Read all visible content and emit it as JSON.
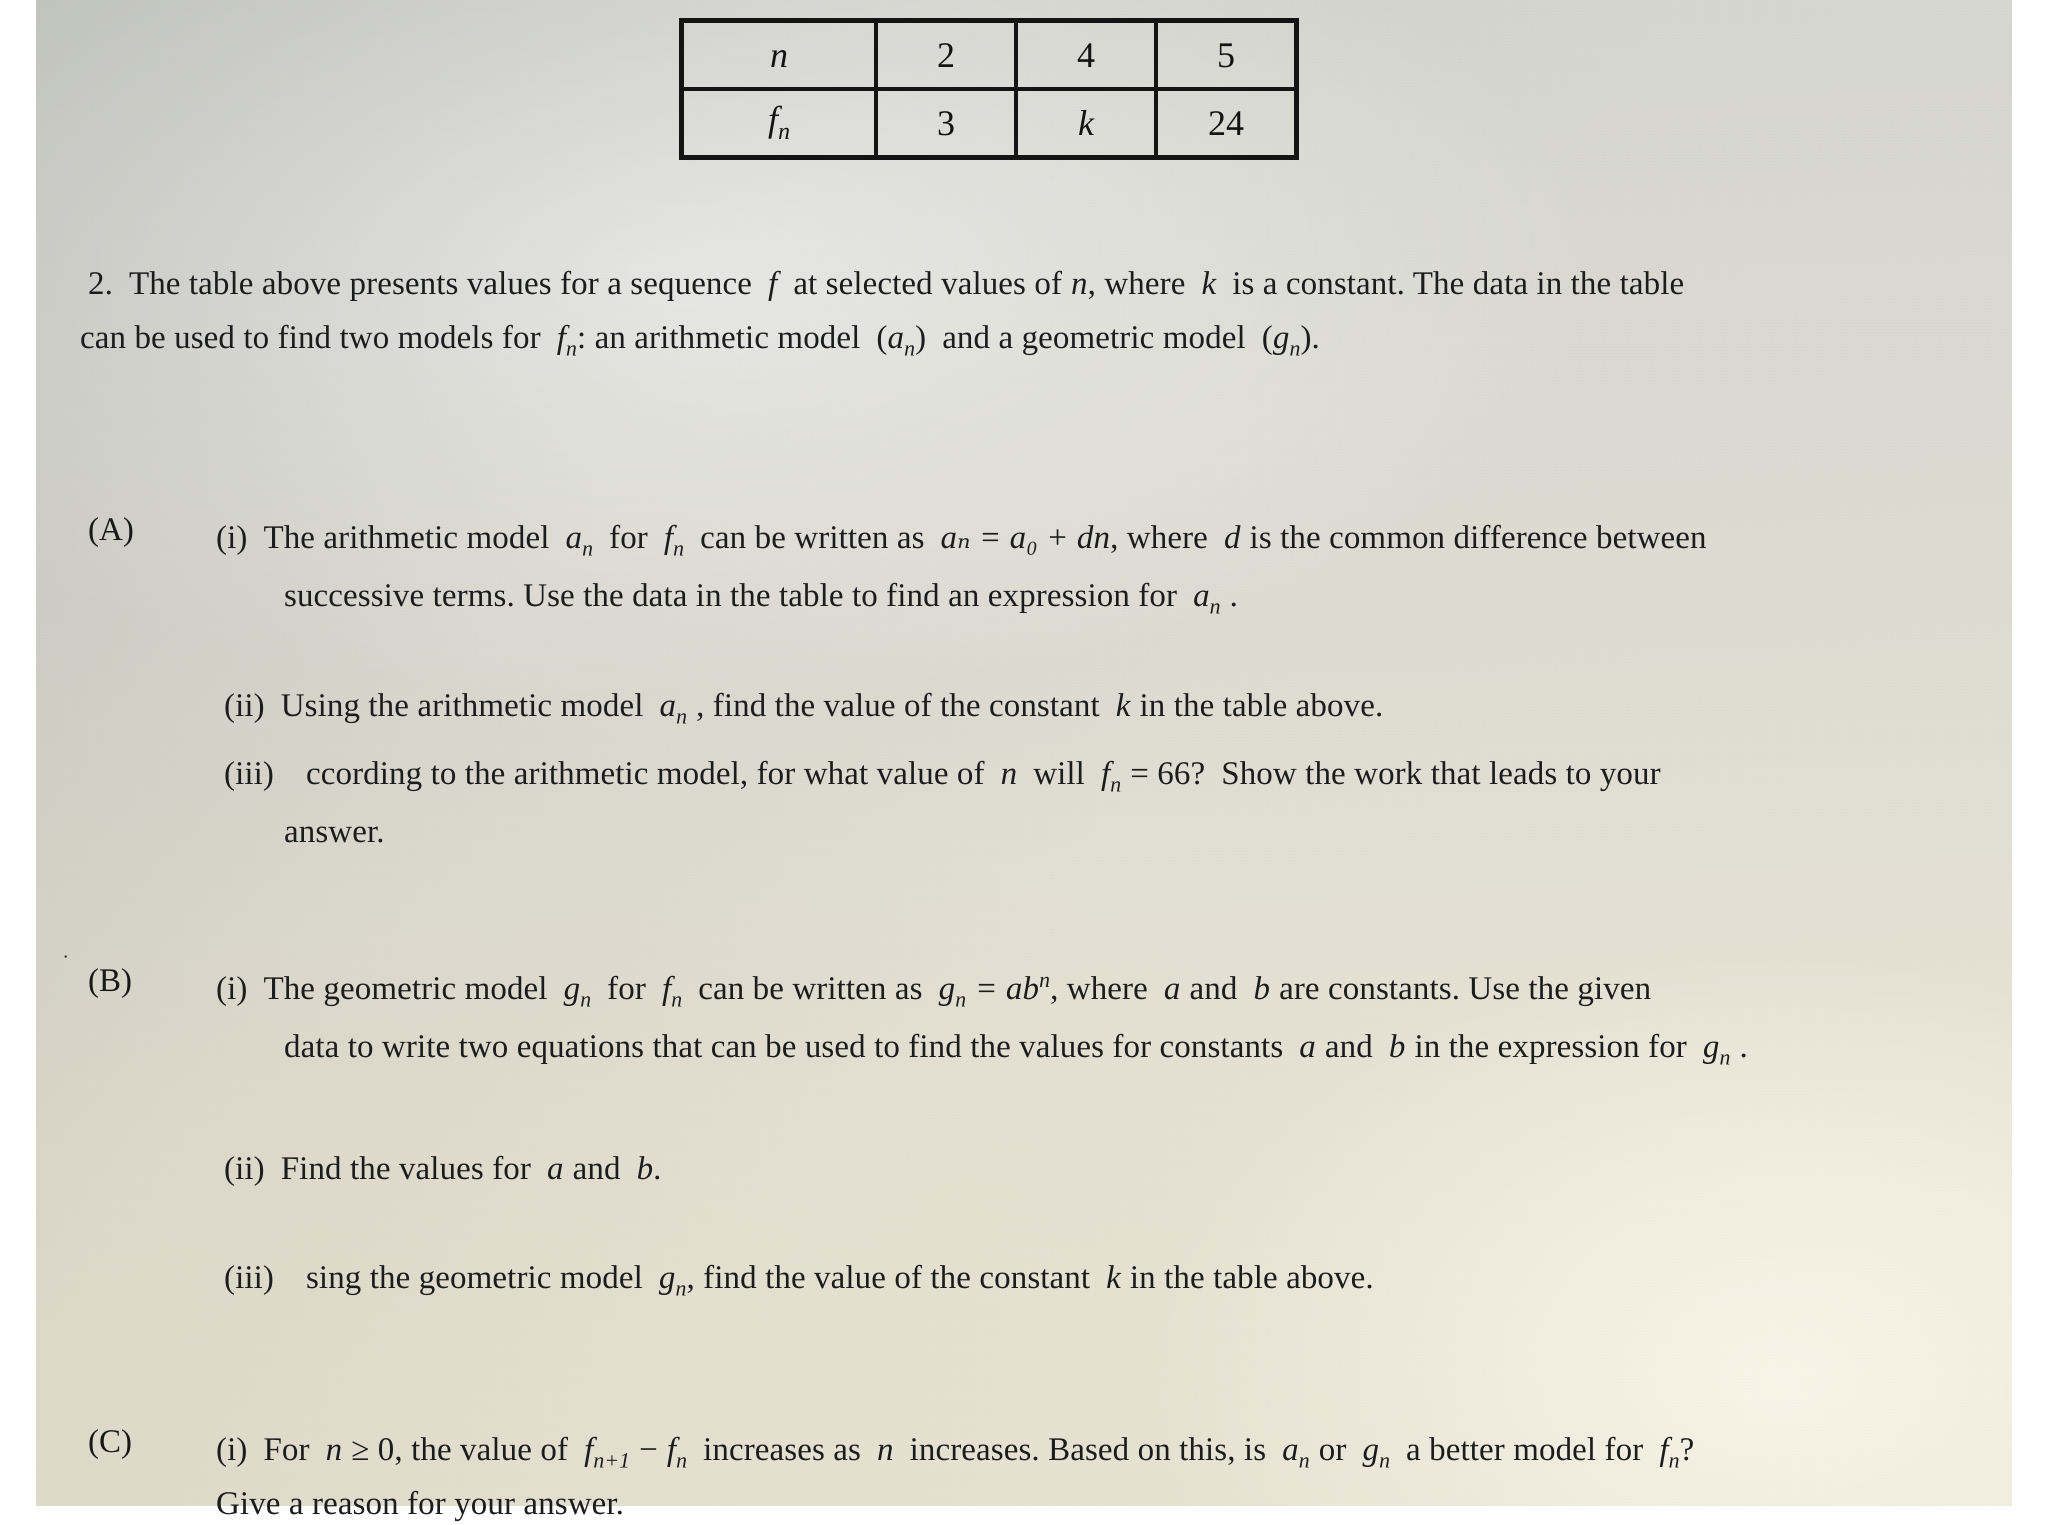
{
  "document": {
    "type": "math-worksheet-photo",
    "question_number": "2."
  },
  "table": {
    "rows": [
      {
        "label": "n",
        "label_sub": "",
        "cells": [
          "2",
          "4",
          "5"
        ]
      },
      {
        "label": "f",
        "label_sub": "n",
        "cells": [
          "3",
          "k",
          "24"
        ]
      }
    ]
  },
  "stem": {
    "line1_a": "2.",
    "line1_b": "The table above presents values for a sequence",
    "line1_f": "f",
    "line1_c": "at selected values of",
    "line1_n": "n",
    "line1_d": ", where",
    "line1_k": "k",
    "line1_e": "is a constant.  The data in the table",
    "line2_a": "can be used to find two models for",
    "line2_fn": "f",
    "line2_fn_sub": "n",
    "line2_b": ":  an arithmetic model",
    "line2_an": "a",
    "line2_an_sub": "n",
    "line2_c": "and a geometric model",
    "line2_gn": "g",
    "line2_gn_sub": "n",
    "line2_d": "."
  },
  "partA": {
    "label": "(A)",
    "items": [
      {
        "roman": "(i)",
        "line1_a": "The arithmetic model",
        "line1_an": "a",
        "line1_an_sub": "n",
        "line1_b": "for",
        "line1_fn": "f",
        "line1_fn_sub": "n",
        "line1_c": "can be written as",
        "equation": "aₙ = a₀ + dn",
        "line1_d": ", where",
        "line1_d_var": "d",
        "line1_e": "is the common difference between",
        "line2": "successive terms.  Use the data in the table to find an expression for",
        "line2_an": "a",
        "line2_an_sub": "n",
        "line2_end": "."
      },
      {
        "roman": "(ii)",
        "line1_a": "Using the arithmetic model",
        "line1_an": "a",
        "line1_an_sub": "n",
        "line1_b": ", find the value of the constant",
        "line1_k": "k",
        "line1_c": "in the table above."
      },
      {
        "roman": "(iii)",
        "line1_a": "ccording to the arithmetic model, for what value of",
        "line1_n": "n",
        "line1_b": "will",
        "line1_fn": "f",
        "line1_fn_sub": "n",
        "line1_eq": "= 66?",
        "line1_c": "Show the work that leads to your",
        "line2": "answer."
      }
    ]
  },
  "partB": {
    "label": "(B)",
    "stray_mark": "˙",
    "items": [
      {
        "roman": "(i)",
        "line1_a": "The geometric model",
        "line1_gn": "g",
        "line1_gn_sub": "n",
        "line1_b": "for",
        "line1_fn": "f",
        "line1_fn_sub": "n",
        "line1_c": "can be written as",
        "equation_lhs": "g",
        "equation_lhs_sub": "n",
        "equation_rhs": "= ab",
        "equation_rhs_sup": "n",
        "line1_d": ", where",
        "line1_a_var": "a",
        "line1_e": "and",
        "line1_b_var": "b",
        "line1_f": "are constants.  Use the given",
        "line2_a": "data to write two equations that can be used to find the values for constants",
        "line2_a_var": "a",
        "line2_b": "and",
        "line2_b_var": "b",
        "line2_c": "in the expression for",
        "line2_gn": "g",
        "line2_gn_sub": "n",
        "line2_end": "."
      },
      {
        "roman": "(ii)",
        "line1_a": "Find the values for",
        "line1_a_var": "a",
        "line1_b": "and",
        "line1_b_var": "b",
        "line1_c": "."
      },
      {
        "roman": "(iii)",
        "line1_a": "sing the geometric model",
        "line1_gn": "g",
        "line1_gn_sub": "n",
        "line1_b": ", find the value of the constant",
        "line1_k": "k",
        "line1_c": "in the table above."
      }
    ]
  },
  "partC": {
    "label": "(C)",
    "items": [
      {
        "roman": "(i)",
        "line1_a": "For",
        "line1_n": "n",
        "line1_ineq": "≥ 0",
        "line1_b": ", the value of",
        "line1_f1": "f",
        "line1_f1_sub": "n+1",
        "line1_minus": "−",
        "line1_f2": "f",
        "line1_f2_sub": "n",
        "line1_c": "increases as",
        "line1_n2": "n",
        "line1_d": "increases.  Based on this, is",
        "line1_an": "a",
        "line1_an_sub": "n",
        "line1_e": "or",
        "line1_gn": "g",
        "line1_gn_sub": "n",
        "line1_f": "a better model for",
        "line1_fn": "f",
        "line1_fn_sub": "n",
        "line1_q": "?",
        "line2": "Give a reason for your answer."
      }
    ]
  },
  "colors": {
    "ink": "#17181a",
    "rule": "#141414",
    "paper_top": "#d5d6d0",
    "paper_bottom": "#ece8d9",
    "page_white": "#ffffff"
  }
}
